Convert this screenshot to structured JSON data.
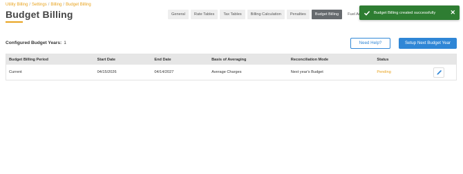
{
  "breadcrumb": [
    "Utility Billing",
    "Settings",
    "Billing",
    "Budget Billing"
  ],
  "page_title": "Budget Billing",
  "tabs": [
    {
      "label": "General",
      "active": false
    },
    {
      "label": "Rate Tables",
      "active": false
    },
    {
      "label": "Tax Tables",
      "active": false
    },
    {
      "label": "Billing Calculation",
      "active": false
    },
    {
      "label": "Penalties",
      "active": false
    },
    {
      "label": "Budget Billing",
      "active": true
    },
    {
      "label": "Fuel Adjus",
      "active": false
    }
  ],
  "toast": {
    "message": "Budget Billing created successfully",
    "close": "✕",
    "color": "#2e7d32"
  },
  "configured": {
    "label": "Configured Budget Years:",
    "count": "1"
  },
  "buttons": {
    "help": "Need Help?",
    "setup": "Setup Next Budget Year"
  },
  "table": {
    "headers": [
      "Budget Billing Period",
      "Start Date",
      "End Date",
      "Basis of Averaging",
      "Reconciliation Mode",
      "Status"
    ],
    "rows": [
      [
        "Current",
        "04/15/2026",
        "04/14/2027",
        "Average Charges",
        "Next year's Budget",
        "Pending"
      ]
    ]
  },
  "colors": {
    "accent": "#e8a21c",
    "primary": "#2f86d6",
    "active_tab": "#666a6e"
  }
}
